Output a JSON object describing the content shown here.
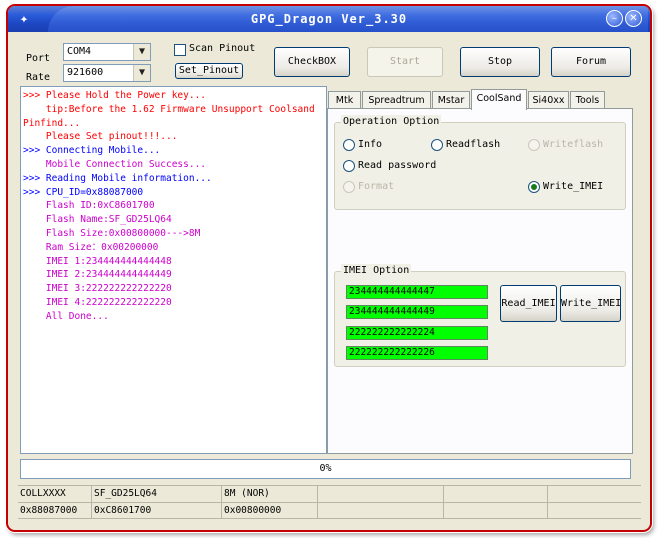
{
  "window": {
    "title": "GPG_Dragon  Ver_3.30",
    "minimize_glyph": "–",
    "close_glyph": "✕",
    "app_icon": "dragon-icon",
    "frame_color": "#c40000"
  },
  "settings": {
    "port_label": "Port",
    "port_value": "COM4",
    "rate_label": "Rate",
    "rate_value": "921600",
    "scan_pinout_label": "Scan Pinout",
    "scan_pinout_checked": false,
    "set_pinout_label": "Set_Pinout"
  },
  "toolbar": {
    "checkbox_label": "CheckBOX",
    "start_label": "Start",
    "stop_label": "Stop",
    "forum_label": "Forum"
  },
  "log": [
    {
      "text": ">>> Please Hold the Power key...",
      "color": "#ff0000"
    },
    {
      "text": "    tip:Before the 1.62 Firmware Unsupport Coolsand",
      "color": "#ff0000"
    },
    {
      "text": "Pinfind...",
      "color": "#ff0000"
    },
    {
      "text": "    Please Set pinout!!!...",
      "color": "#ff0000"
    },
    {
      "text": ">>> Connecting Mobile...",
      "color": "#0000ff"
    },
    {
      "text": "    Mobile Connection Success...",
      "color": "#cc00cc"
    },
    {
      "text": ">>> Reading Mobile information...",
      "color": "#0000ff"
    },
    {
      "text": ">>> CPU_ID=0x88087000",
      "color": "#0000ff"
    },
    {
      "text": "    Flash ID:0xC8601700",
      "color": "#cc00cc"
    },
    {
      "text": "    Flash Name:SF_GD25LQ64",
      "color": "#cc00cc"
    },
    {
      "text": "    Flash Size:0x00800000--->8M",
      "color": "#cc00cc"
    },
    {
      "text": "    Ram Size：0x00200000",
      "color": "#cc00cc"
    },
    {
      "text": "    IMEI 1:234444444444448",
      "color": "#cc00cc"
    },
    {
      "text": "    IMEI 2:234444444444449",
      "color": "#cc00cc"
    },
    {
      "text": "    IMEI 3:222222222222220",
      "color": "#cc00cc"
    },
    {
      "text": "    IMEI 4:222222222222220",
      "color": "#cc00cc"
    },
    {
      "text": "    All Done...",
      "color": "#cc00cc"
    }
  ],
  "tabs": [
    {
      "label": "Mtk",
      "active": false
    },
    {
      "label": "Spreadtrum",
      "active": false
    },
    {
      "label": "Mstar",
      "active": false
    },
    {
      "label": "CoolSand",
      "active": true
    },
    {
      "label": "Si40xx",
      "active": false
    },
    {
      "label": "Tools",
      "active": false
    }
  ],
  "operation": {
    "title": "Operation Option",
    "info_label": "Info",
    "readflash_label": "Readflash",
    "writeflash_label": "Writeflash",
    "read_password_label": "Read password",
    "format_label": "Format",
    "write_imei_label": "Write_IMEI",
    "selected": "Write_IMEI"
  },
  "imei": {
    "title": "IMEI Option",
    "fields": [
      "234444444444447",
      "234444444444449",
      "222222222222224",
      "222222222222226"
    ],
    "field_color": "#00ff00",
    "read_button": "Read_IMEI",
    "write_button": "Write_IMEI"
  },
  "progress": {
    "text": "0%",
    "value": 0
  },
  "status": {
    "row1": [
      "COLLXXXX",
      "SF_GD25LQ64",
      "8M (NOR)",
      "",
      "",
      ""
    ],
    "row2": [
      "0x88087000",
      "0xC8601700",
      "0x00800000",
      "",
      "",
      ""
    ]
  }
}
